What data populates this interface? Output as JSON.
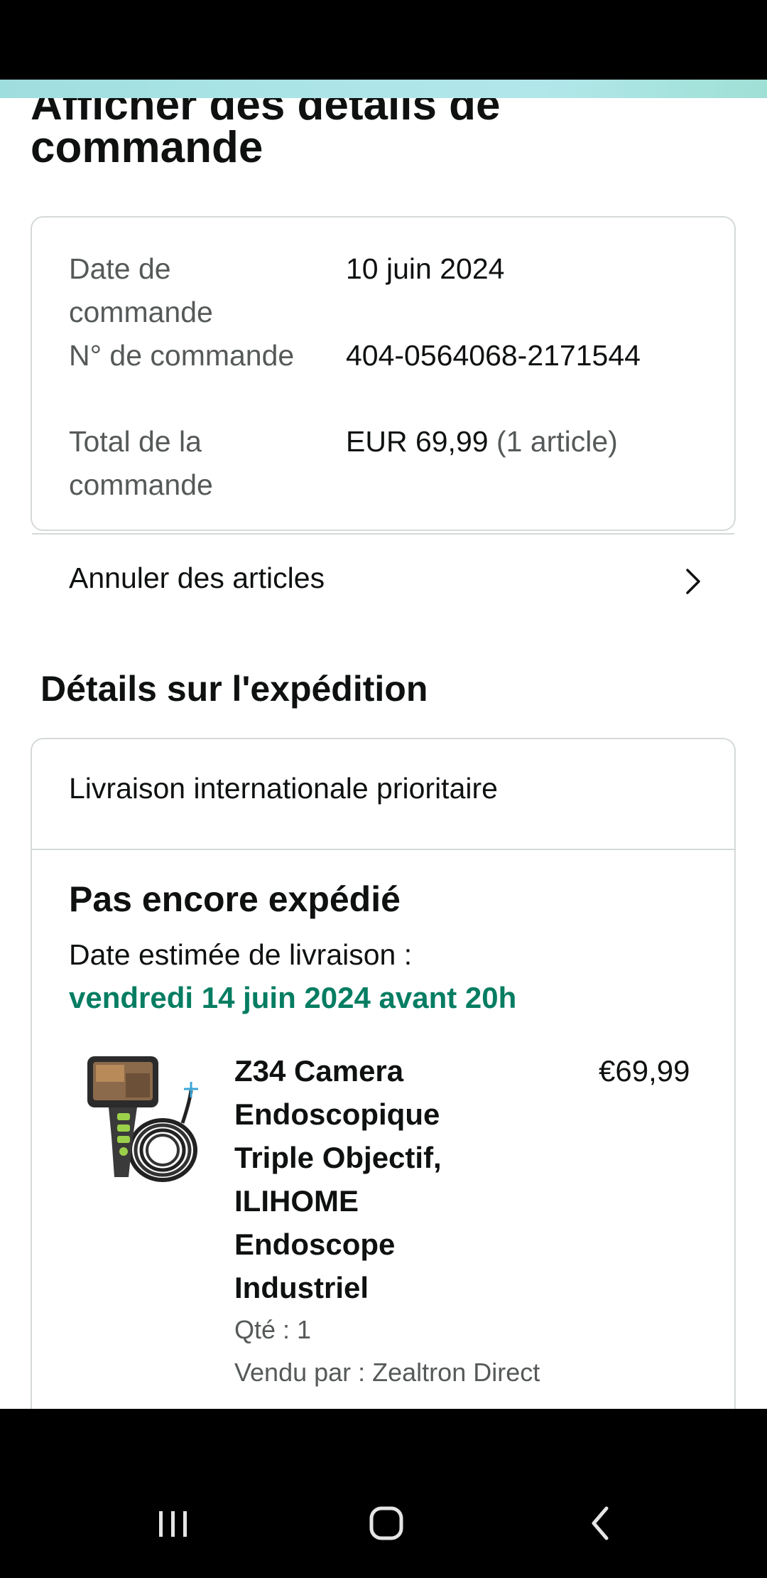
{
  "page": {
    "title_line1": "Afficher des détails de",
    "title_line2": "commande"
  },
  "order_summary": {
    "date_label": "Date de commande",
    "date_value": "10 juin 2024",
    "number_label": "N° de commande",
    "number_value": "404-0564068-2171544",
    "total_label": "Total de la commande",
    "total_amount": "EUR 69,99",
    "total_count": "(1 article)",
    "cancel_label": "Annuler des articles"
  },
  "shipping": {
    "section_title": "Détails sur l'expédition",
    "method": "Livraison internationale prioritaire",
    "status": "Pas encore expédié",
    "eta_label": "Date estimée de livraison :",
    "eta_value": "vendredi 14 juin 2024 avant 20h",
    "eta_color": "#067d62"
  },
  "item": {
    "title": "Z34 Camera Endoscopique Triple Objectif, ILIHOME Endoscope Industriel",
    "price": "€69,99",
    "qty": "Qté : 1",
    "seller": "Vendu par : Zealtron Direct",
    "image_icon": "endoscope-camera-image"
  },
  "nav": {
    "recent_icon": "recent-apps-icon",
    "home_icon": "home-icon",
    "back_icon": "back-icon"
  }
}
